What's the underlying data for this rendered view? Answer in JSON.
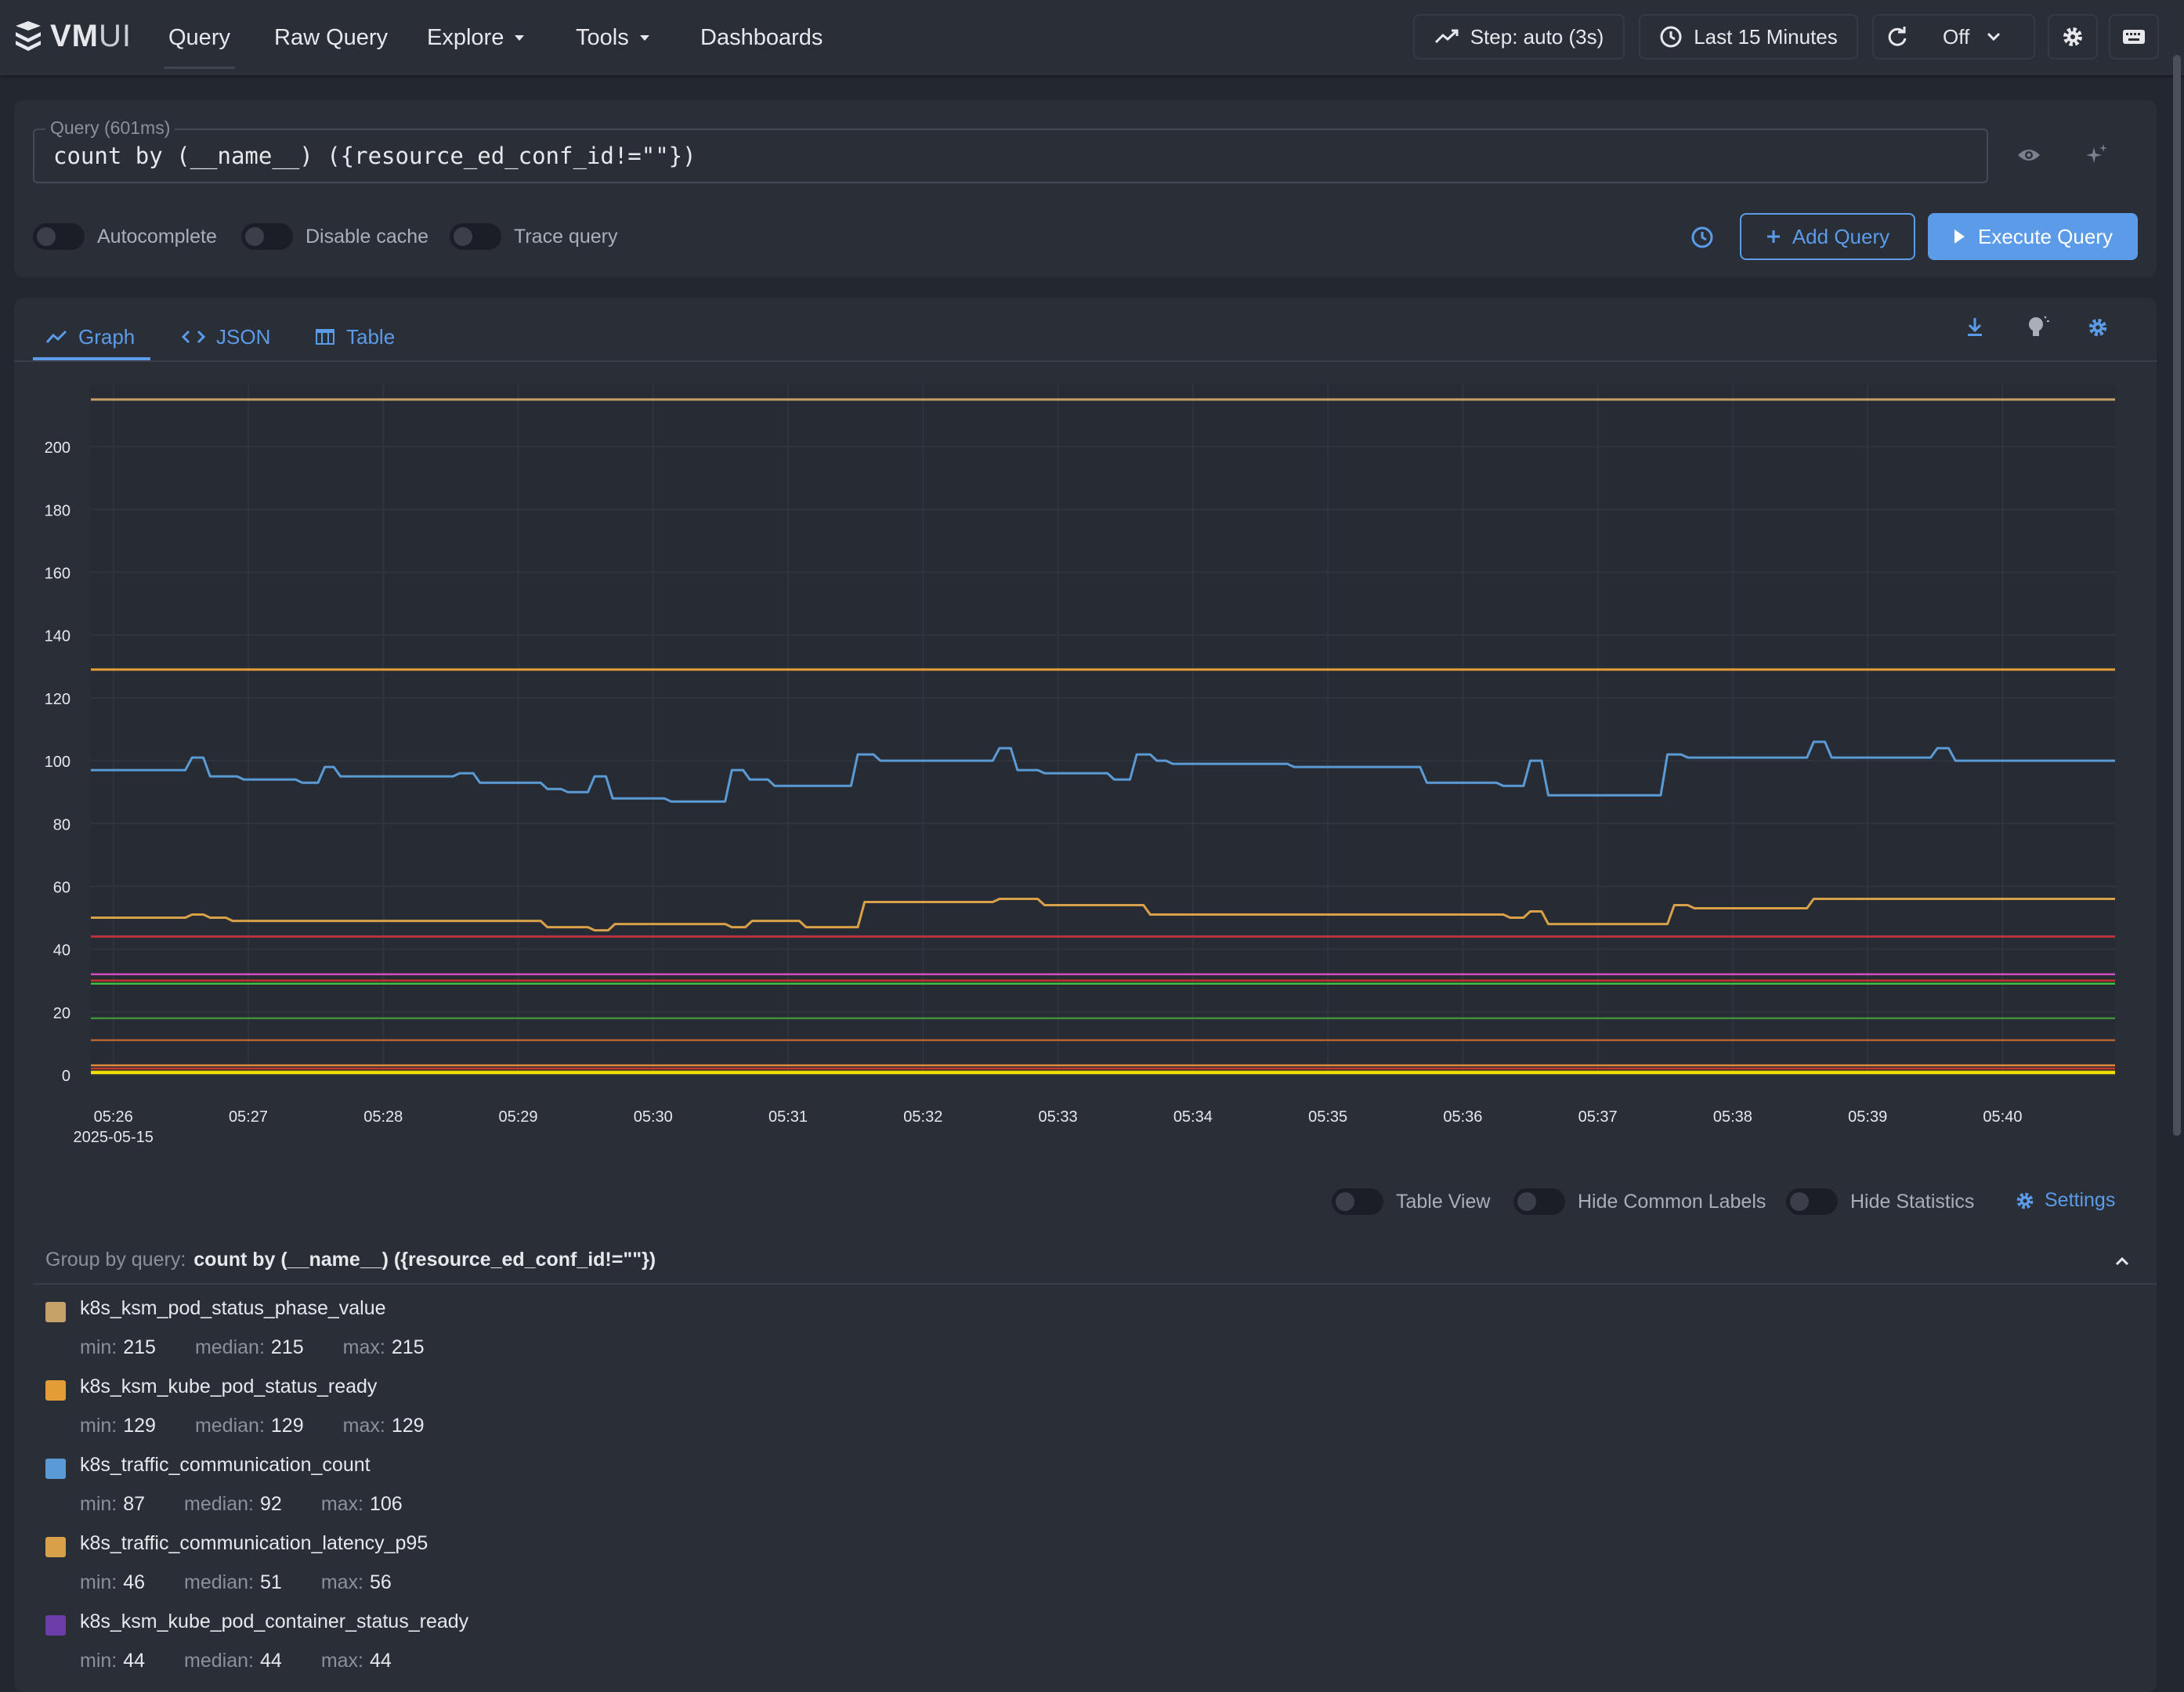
{
  "app": {
    "logo_text_bold": "VM",
    "logo_text_light": "UI",
    "nav": [
      "Query",
      "Raw Query",
      "Explore",
      "Tools",
      "Dashboards"
    ],
    "step_label": "Step: auto (3s)",
    "time_range_label": "Last 15 Minutes",
    "refresh_label": "Off"
  },
  "query": {
    "legend": "Query (601ms)",
    "expr": "count by (__name__) ({resource_ed_conf_id!=\"\"})",
    "toggles": [
      "Autocomplete",
      "Disable cache",
      "Trace query"
    ],
    "add_label": "Add Query",
    "execute_label": "Execute Query"
  },
  "tabs": [
    "Graph",
    "JSON",
    "Table"
  ],
  "graph_options": {
    "table_view": "Table View",
    "hide_common": "Hide Common Labels",
    "hide_stats": "Hide Statistics",
    "settings": "Settings"
  },
  "group": {
    "label": "Group by query:",
    "query": "count by (__name__) ({resource_ed_conf_id!=\"\"})"
  },
  "legend": [
    {
      "name": "k8s_ksm_pod_status_phase_value",
      "color": "#c7a268",
      "min": "215",
      "median": "215",
      "max": "215"
    },
    {
      "name": "k8s_ksm_kube_pod_status_ready",
      "color": "#e39d36",
      "min": "129",
      "median": "129",
      "max": "129"
    },
    {
      "name": "k8s_traffic_communication_count",
      "color": "#5b9bd5",
      "min": "87",
      "median": "92",
      "max": "106"
    },
    {
      "name": "k8s_traffic_communication_latency_p95",
      "color": "#d9a04a",
      "min": "46",
      "median": "51",
      "max": "56"
    },
    {
      "name": "k8s_ksm_kube_pod_container_status_ready",
      "color": "#6a3da8",
      "min": "44",
      "median": "44",
      "max": "44"
    }
  ],
  "stat_labels": {
    "min": "min:",
    "median": "median:",
    "max": "max:"
  },
  "chart_data": {
    "type": "line",
    "ylim": [
      0,
      220
    ],
    "yticks": [
      0,
      20,
      40,
      60,
      80,
      100,
      120,
      140,
      160,
      180,
      200
    ],
    "xticks": [
      "05:26",
      "05:27",
      "05:28",
      "05:29",
      "05:30",
      "05:31",
      "05:32",
      "05:33",
      "05:34",
      "05:35",
      "05:36",
      "05:37",
      "05:38",
      "05:39",
      "05:40"
    ],
    "x_date_label": "2025-05-15",
    "x_start": "05:25:50",
    "x_end": "05:40:50",
    "series": [
      {
        "name": "k8s_ksm_pod_status_phase_value",
        "color": "#c7a268",
        "values": [
          [
            0,
            215
          ],
          [
            900,
            215
          ]
        ]
      },
      {
        "name": "k8s_ksm_kube_pod_status_ready",
        "color": "#e39d36",
        "values": [
          [
            0,
            129
          ],
          [
            900,
            129
          ]
        ]
      },
      {
        "name": "k8s_traffic_communication_count",
        "color": "#5b9bd5",
        "values": [
          [
            0,
            97
          ],
          [
            42,
            97
          ],
          [
            45,
            101
          ],
          [
            50,
            101
          ],
          [
            53,
            95
          ],
          [
            65,
            95
          ],
          [
            68,
            94
          ],
          [
            91,
            94
          ],
          [
            94,
            93
          ],
          [
            101,
            93
          ],
          [
            104,
            98
          ],
          [
            108,
            98
          ],
          [
            111,
            95
          ],
          [
            161,
            95
          ],
          [
            164,
            96
          ],
          [
            170,
            96
          ],
          [
            173,
            93
          ],
          [
            200,
            93
          ],
          [
            203,
            91
          ],
          [
            209,
            91
          ],
          [
            212,
            90
          ],
          [
            221,
            90
          ],
          [
            224,
            95
          ],
          [
            229,
            95
          ],
          [
            232,
            88
          ],
          [
            255,
            88
          ],
          [
            258,
            87
          ],
          [
            282,
            87
          ],
          [
            285,
            97
          ],
          [
            290,
            97
          ],
          [
            293,
            94
          ],
          [
            301,
            94
          ],
          [
            304,
            92
          ],
          [
            338,
            92
          ],
          [
            341,
            102
          ],
          [
            348,
            102
          ],
          [
            351,
            100
          ],
          [
            401,
            100
          ],
          [
            404,
            104
          ],
          [
            409,
            104
          ],
          [
            412,
            97
          ],
          [
            421,
            97
          ],
          [
            424,
            96
          ],
          [
            452,
            96
          ],
          [
            455,
            94
          ],
          [
            462,
            94
          ],
          [
            465,
            102
          ],
          [
            471,
            102
          ],
          [
            474,
            100
          ],
          [
            478,
            100
          ],
          [
            481,
            99
          ],
          [
            532,
            99
          ],
          [
            535,
            98
          ],
          [
            591,
            98
          ],
          [
            594,
            93
          ],
          [
            625,
            93
          ],
          [
            628,
            92
          ],
          [
            637,
            92
          ],
          [
            640,
            100
          ],
          [
            645,
            100
          ],
          [
            648,
            89
          ],
          [
            698,
            89
          ],
          [
            701,
            102
          ],
          [
            707,
            102
          ],
          [
            710,
            101
          ],
          [
            763,
            101
          ],
          [
            766,
            106
          ],
          [
            771,
            106
          ],
          [
            774,
            101
          ],
          [
            818,
            101
          ],
          [
            821,
            104
          ],
          [
            826,
            104
          ],
          [
            829,
            100
          ],
          [
            900,
            100
          ]
        ]
      },
      {
        "name": "k8s_traffic_communication_latency_p95",
        "color": "#d9a04a",
        "values": [
          [
            0,
            50
          ],
          [
            42,
            50
          ],
          [
            45,
            51
          ],
          [
            50,
            51
          ],
          [
            53,
            50
          ],
          [
            60,
            50
          ],
          [
            63,
            49
          ],
          [
            101,
            49
          ],
          [
            104,
            49
          ],
          [
            200,
            49
          ],
          [
            203,
            47
          ],
          [
            221,
            47
          ],
          [
            224,
            46
          ],
          [
            230,
            46
          ],
          [
            233,
            48
          ],
          [
            282,
            48
          ],
          [
            285,
            47
          ],
          [
            291,
            47
          ],
          [
            294,
            49
          ],
          [
            303,
            49
          ],
          [
            306,
            49
          ],
          [
            315,
            49
          ],
          [
            318,
            47
          ],
          [
            341,
            47
          ],
          [
            344,
            55
          ],
          [
            401,
            55
          ],
          [
            404,
            56
          ],
          [
            421,
            56
          ],
          [
            424,
            54
          ],
          [
            468,
            54
          ],
          [
            471,
            51
          ],
          [
            628,
            51
          ],
          [
            631,
            50
          ],
          [
            637,
            50
          ],
          [
            640,
            52
          ],
          [
            645,
            52
          ],
          [
            648,
            48
          ],
          [
            701,
            48
          ],
          [
            704,
            54
          ],
          [
            710,
            54
          ],
          [
            713,
            53
          ],
          [
            763,
            53
          ],
          [
            766,
            56
          ],
          [
            900,
            56
          ]
        ]
      },
      {
        "name": "k8s_ksm_kube_pod_container_status_ready",
        "color": "#6a3da8",
        "values": [
          [
            0,
            44
          ],
          [
            900,
            44
          ]
        ]
      }
    ]
  }
}
